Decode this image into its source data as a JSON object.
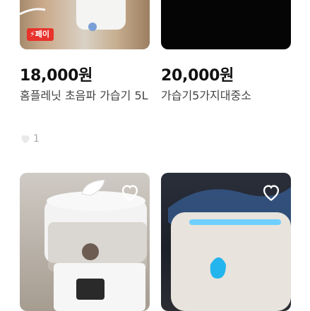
{
  "listings": [
    {
      "price": "18,000원",
      "title": "홈플레닛 초음파 가습기 5L",
      "badge": "페이",
      "likes": "1"
    },
    {
      "price": "20,000원",
      "title": "가습기5가지대중소"
    },
    {
      "image": "humidifier"
    },
    {
      "image": "flame humidifier"
    }
  ]
}
